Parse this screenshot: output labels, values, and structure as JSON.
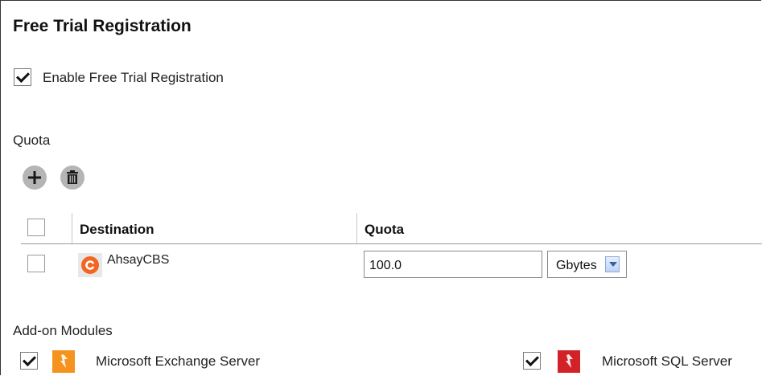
{
  "page": {
    "title": "Free Trial Registration"
  },
  "enable_trial": {
    "label": "Enable Free Trial Registration",
    "checked": true
  },
  "quota_section": {
    "label": "Quota",
    "toolbar": {
      "add_icon": "plus-icon",
      "delete_icon": "trash-icon"
    },
    "table": {
      "headers": [
        "Destination",
        "Quota"
      ],
      "rows": [
        {
          "checked": false,
          "destination": "AhsayCBS",
          "icon": "ahsay-logo-icon",
          "quota_value": "100.0",
          "unit": "Gbytes"
        }
      ]
    }
  },
  "addons": {
    "label": "Add-on Modules",
    "items": [
      {
        "label": "Microsoft Exchange Server",
        "checked": true,
        "icon": "exchange-icon",
        "color": "#f6931e"
      },
      {
        "label": "Microsoft SQL Server",
        "checked": true,
        "icon": "sql-server-icon",
        "color": "#d22127"
      }
    ]
  },
  "colors": {
    "ahsay_orange": "#f26522",
    "dropdown_arrow": "#3a5fa8"
  }
}
